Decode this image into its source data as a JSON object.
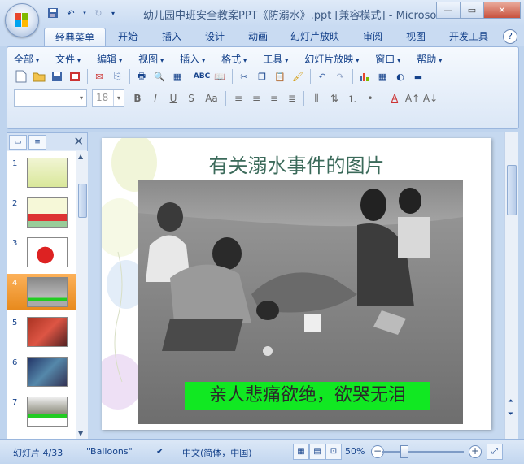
{
  "window": {
    "title": "幼儿园中班安全教案PPT《防溺水》.ppt [兼容模式] - Microso...",
    "minimize_icon": "minimize-icon",
    "maximize_icon": "maximize-icon",
    "close_icon": "close-icon"
  },
  "ribbon": {
    "tabs": [
      "经典菜单",
      "开始",
      "插入",
      "设计",
      "动画",
      "幻灯片放映",
      "审阅",
      "视图",
      "开发工具"
    ],
    "active_tab": "经典菜单",
    "menus": [
      "全部",
      "文件",
      "编辑",
      "视图",
      "插入",
      "格式",
      "工具",
      "幻灯片放映",
      "窗口",
      "帮助"
    ],
    "font_size": "18"
  },
  "slides_panel": {
    "numbers": [
      "1",
      "2",
      "3",
      "4",
      "5",
      "6",
      "7"
    ],
    "active_index": 4
  },
  "slide": {
    "title": "有关溺水事件的图片",
    "caption": "亲人悲痛欲绝，欲哭无泪"
  },
  "status": {
    "slide_info": "幻灯片 4/33",
    "theme": "\"Balloons\"",
    "language": "中文(简体，中国)",
    "zoom": "50%"
  },
  "colors": {
    "caption_bg": "#11e822",
    "active_thumb": "#f5a343",
    "title_text": "#3b6a5a"
  }
}
